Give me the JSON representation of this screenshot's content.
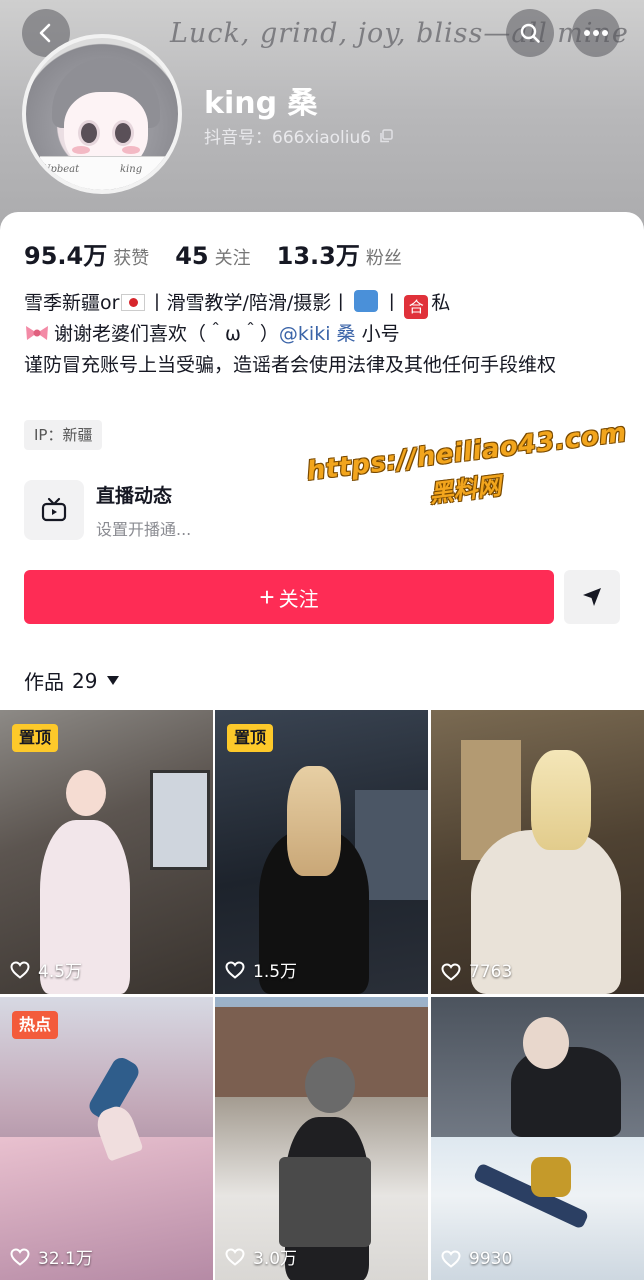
{
  "header": {
    "banner_text": "Luck, grind, joy, bliss—all mine",
    "name": "king 桑",
    "douyin_id": "抖音号：666xiaoliu6"
  },
  "avatar": {
    "card_left": "Upbeat",
    "card_right": "king"
  },
  "stats": [
    {
      "value": "95.4万",
      "label": "获赞"
    },
    {
      "value": "45",
      "label": "关注"
    },
    {
      "value": "13.3万",
      "label": "粉丝"
    }
  ],
  "bio": {
    "line1_a": "雪季新疆or",
    "line1_b": "丨滑雪教学/陪滑/摄影丨",
    "line1_c": "丨",
    "line1_d": "私",
    "he_char": "合",
    "line2_a": "谢谢老婆们喜欢（＾ω＾）",
    "line2_mention": "@kiki 桑",
    "line2_b": " 小号",
    "line3": "谨防冒充账号上当受骗，造谣者会使用法律及其他任何手段维权"
  },
  "ip_tag": "IP：新疆",
  "live": {
    "title": "直播动态",
    "subtitle": "设置开播通..."
  },
  "watermark": {
    "url": "https://heiliao43.com",
    "name": "黑料网"
  },
  "follow_button": {
    "plus": "+",
    "label": "关注"
  },
  "works": {
    "label": "作品",
    "count": "29"
  },
  "videos": [
    {
      "likes": "4.5万",
      "badge": "置顶"
    },
    {
      "likes": "1.5万",
      "badge": "置顶"
    },
    {
      "likes": "7763",
      "badge": ""
    },
    {
      "likes": "32.1万",
      "badge": "热点"
    },
    {
      "likes": "3.0万",
      "badge": ""
    },
    {
      "likes": "9930",
      "badge": ""
    }
  ],
  "colors": {
    "accent": "#fe2c55",
    "pin_badge": "#fdc92a",
    "hot_badge": "#f35b3b",
    "mention": "#3b64a8"
  }
}
